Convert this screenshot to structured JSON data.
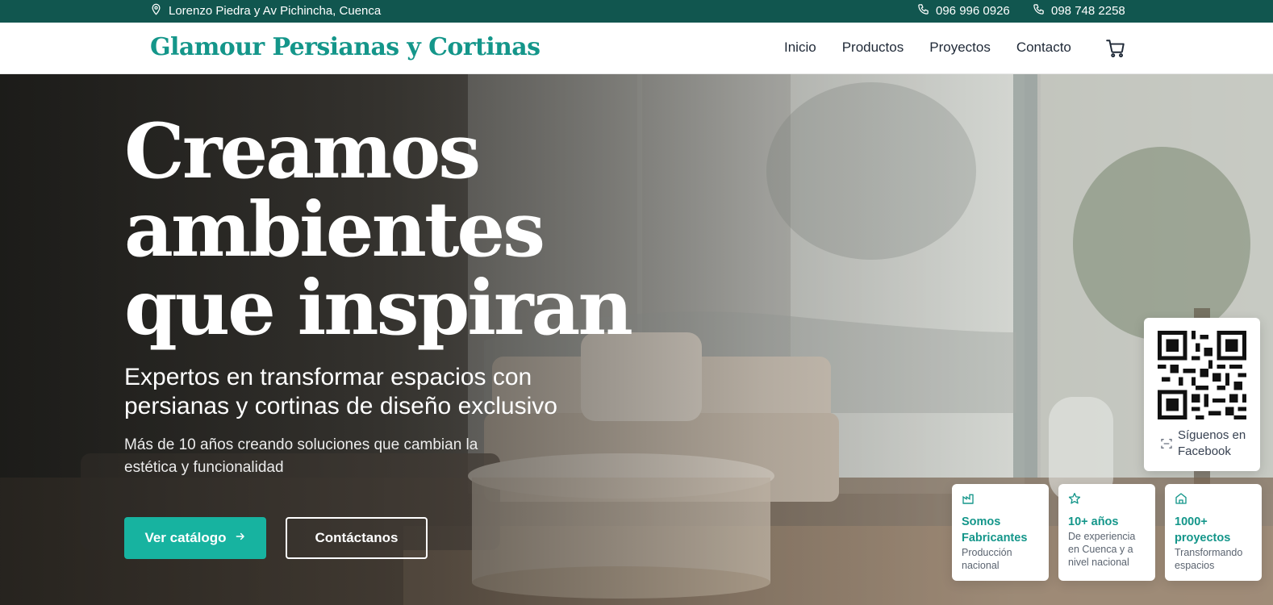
{
  "topbar": {
    "address": "Lorenzo Piedra y Av Pichincha, Cuenca",
    "phone1": "096 996 0926",
    "phone2": "098 748 2258"
  },
  "nav": {
    "logo": "Glamour Persianas y Cortinas",
    "links": [
      "Inicio",
      "Productos",
      "Proyectos",
      "Contacto"
    ]
  },
  "hero": {
    "title_lines": [
      "Creamos",
      "ambientes",
      "que inspiran"
    ],
    "subtitle": "Expertos en transformar espacios con persianas y cortinas de diseño exclusivo",
    "description": "Más de 10 años creando soluciones que cambian la estética y funcionalidad",
    "primary_button": "Ver catálogo",
    "secondary_button": "Contáctanos"
  },
  "qr": {
    "label": "Síguenos en Facebook"
  },
  "stats": [
    {
      "title": "Somos Fabricantes",
      "desc": "Producción nacional",
      "icon": "factory-icon"
    },
    {
      "title": "10+ años",
      "desc": "De experiencia en Cuenca y a nivel nacional",
      "icon": "star-icon"
    },
    {
      "title": "1000+ proyectos",
      "desc": "Transformando espacios",
      "icon": "home-icon"
    }
  ],
  "colors": {
    "topbar_bg": "#11564f",
    "brand": "#14968a",
    "button": "#17b3a0"
  }
}
